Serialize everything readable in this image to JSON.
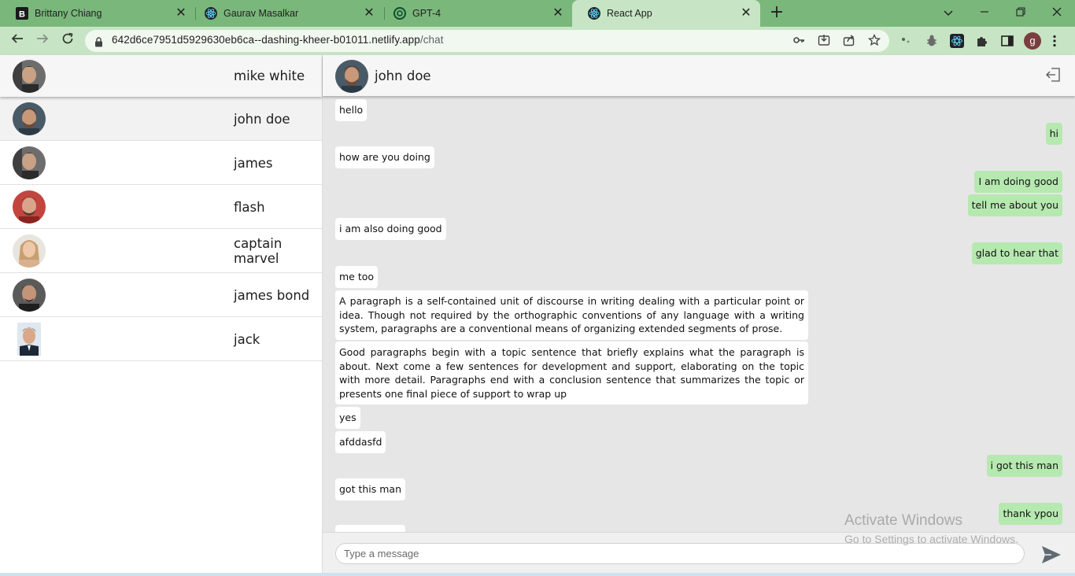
{
  "browser": {
    "tabs": [
      {
        "title": "Brittany Chiang",
        "icon": "b-favicon"
      },
      {
        "title": "Gaurav Masalkar",
        "icon": "react-favicon"
      },
      {
        "title": "GPT-4",
        "icon": "openai-favicon"
      },
      {
        "title": "React App",
        "icon": "react-favicon",
        "active": true
      }
    ],
    "url_host": "642d6ce7951d5929630eb6ca--dashing-kheer-b01011.netlify.app",
    "url_path": "/chat",
    "profile_initial": "g"
  },
  "sidebar": {
    "contacts": [
      {
        "name": "mike white"
      },
      {
        "name": "john doe"
      },
      {
        "name": "james"
      },
      {
        "name": "flash"
      },
      {
        "name": "captain marvel"
      },
      {
        "name": "james bond"
      },
      {
        "name": "jack"
      }
    ]
  },
  "chat": {
    "header_name": "john doe",
    "messages": [
      {
        "dir": "in",
        "text": "hello"
      },
      {
        "dir": "out",
        "text": "hi"
      },
      {
        "dir": "in",
        "text": "how are you doing"
      },
      {
        "dir": "out",
        "text": "I am doing good"
      },
      {
        "dir": "out",
        "text": "tell me about you"
      },
      {
        "dir": "in",
        "text": "i am also doing good"
      },
      {
        "dir": "out",
        "text": "glad to hear that"
      },
      {
        "dir": "in",
        "text": "me too"
      },
      {
        "dir": "in",
        "text": "A paragraph is a self-contained unit of discourse in writing dealing with a particular point or idea. Though not required by the orthographic conventions of any language with a writing system, paragraphs are a conventional means of organizing extended segments of prose."
      },
      {
        "dir": "in",
        "text": "Good paragraphs begin with a topic sentence that briefly explains what the paragraph is about. Next come a few sentences for development and support, elaborating on the topic with more detail. Paragraphs end with a conclusion sentence that summarizes the topic or presents one final piece of support to wrap up"
      },
      {
        "dir": "in",
        "text": "yes"
      },
      {
        "dir": "in",
        "text": "afddasfd"
      },
      {
        "dir": "out",
        "text": "i got this man"
      },
      {
        "dir": "in",
        "text": "got this man"
      },
      {
        "dir": "out",
        "text": "thank ypou"
      }
    ],
    "input_placeholder": "Type a message"
  },
  "watermark": {
    "line1": "Activate Windows",
    "line2": "Go to Settings to activate Windows."
  },
  "colors": {
    "tabbar": "#7ab77b",
    "toolbar": "#c7e5c4",
    "incoming_bubble": "#ffffff",
    "outgoing_bubble": "#b6e9b0",
    "chat_background": "#e6e6e6"
  }
}
